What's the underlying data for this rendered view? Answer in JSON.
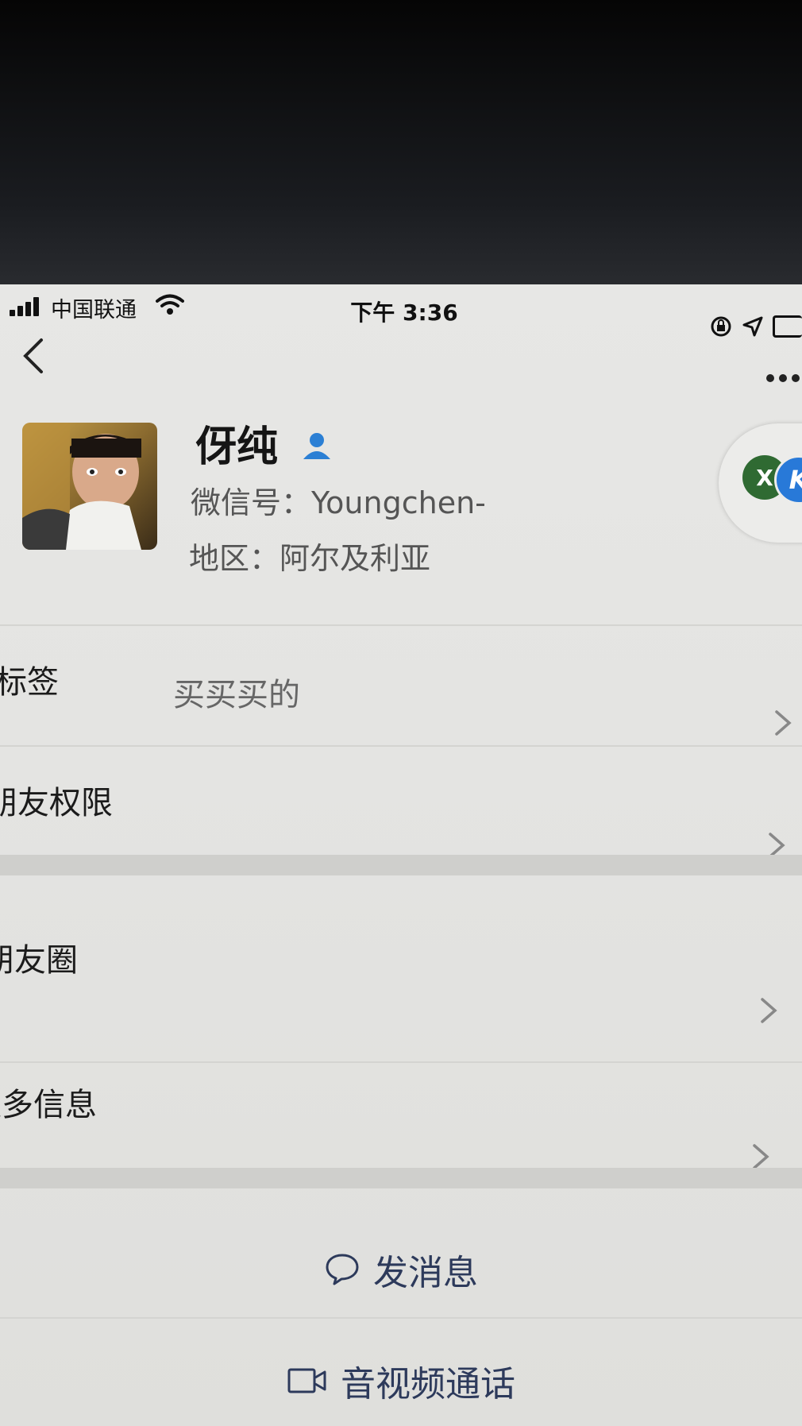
{
  "status_bar": {
    "carrier": "中国联通",
    "time": "下午 3:36"
  },
  "profile": {
    "name": "伢纯",
    "wechat_id_label": "微信号：",
    "wechat_id": "Youngchen-",
    "region_label": "地区：",
    "region": "阿尔及利亚"
  },
  "badge": {
    "left_letter": "X",
    "right_letter": "K"
  },
  "rows": {
    "tags_label": "标签",
    "tags_value": "买买买的",
    "permissions_label": "朋友权限",
    "moments_label": "朋友圈",
    "more_info_label": "更多信息"
  },
  "actions": {
    "message": "发消息",
    "call": "音视频通话"
  },
  "colors": {
    "action_text": "#2d3a5b",
    "contact_icon": "#2b7fd4",
    "badge_green": "#2f6a32",
    "badge_blue": "#2879d8"
  }
}
